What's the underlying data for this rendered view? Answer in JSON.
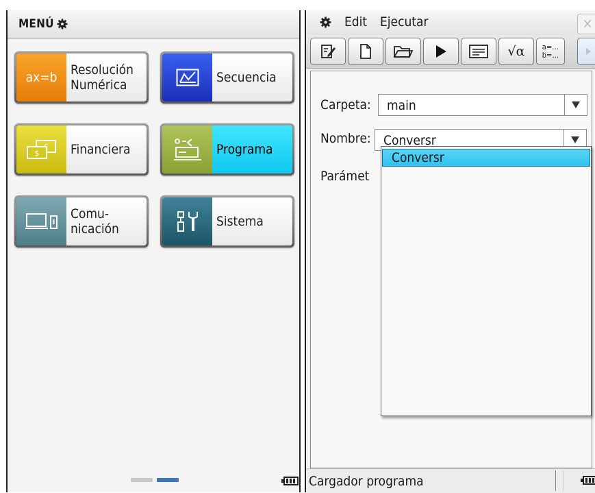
{
  "left": {
    "menu_title": "MENÚ",
    "apps": [
      {
        "line1": "Resolución",
        "line2": "Numérica",
        "icon": "equation-icon",
        "icon_text": "ax=b",
        "color": "#f08a12"
      },
      {
        "line1": "Secuencia",
        "line2": "",
        "icon": "sequence-graph-icon",
        "color": "#1f3fd0"
      },
      {
        "line1": "Financiera",
        "line2": "",
        "icon": "money-icon",
        "color": "#d8cc22"
      },
      {
        "line1": "Programa",
        "line2": "",
        "icon": "program-icon",
        "color": "#9bb13f",
        "selected": true
      },
      {
        "line1": "Comu-",
        "line2": "nicación",
        "icon": "communication-icon",
        "color": "#5e8f9a"
      },
      {
        "line1": "Sistema",
        "line2": "",
        "icon": "tools-icon",
        "color": "#2c6b7e"
      }
    ],
    "page_indicator": {
      "pages": 2,
      "current": 2,
      "inactive_color": "#c9c9c9",
      "active_color": "#3e78b8"
    }
  },
  "right": {
    "menu": {
      "edit": "Edit",
      "run": "Ejecutar",
      "close": "×"
    },
    "toolbar": [
      "edit-icon",
      "new-file-icon",
      "open-folder-icon",
      "run-icon",
      "text-window-icon",
      "math-icon",
      "variables-icon",
      "more-icon"
    ],
    "toolbar_math_text": "√α",
    "toolbar_var_text1": "a=…",
    "toolbar_var_text2": "b=…",
    "form": {
      "folder_label": "Carpeta:",
      "folder_value": "main",
      "name_label": "Nombre:",
      "name_value": "Conversr",
      "params_label": "Parámet",
      "dropdown_items": [
        "Conversr"
      ]
    },
    "status": "Cargador programa"
  }
}
